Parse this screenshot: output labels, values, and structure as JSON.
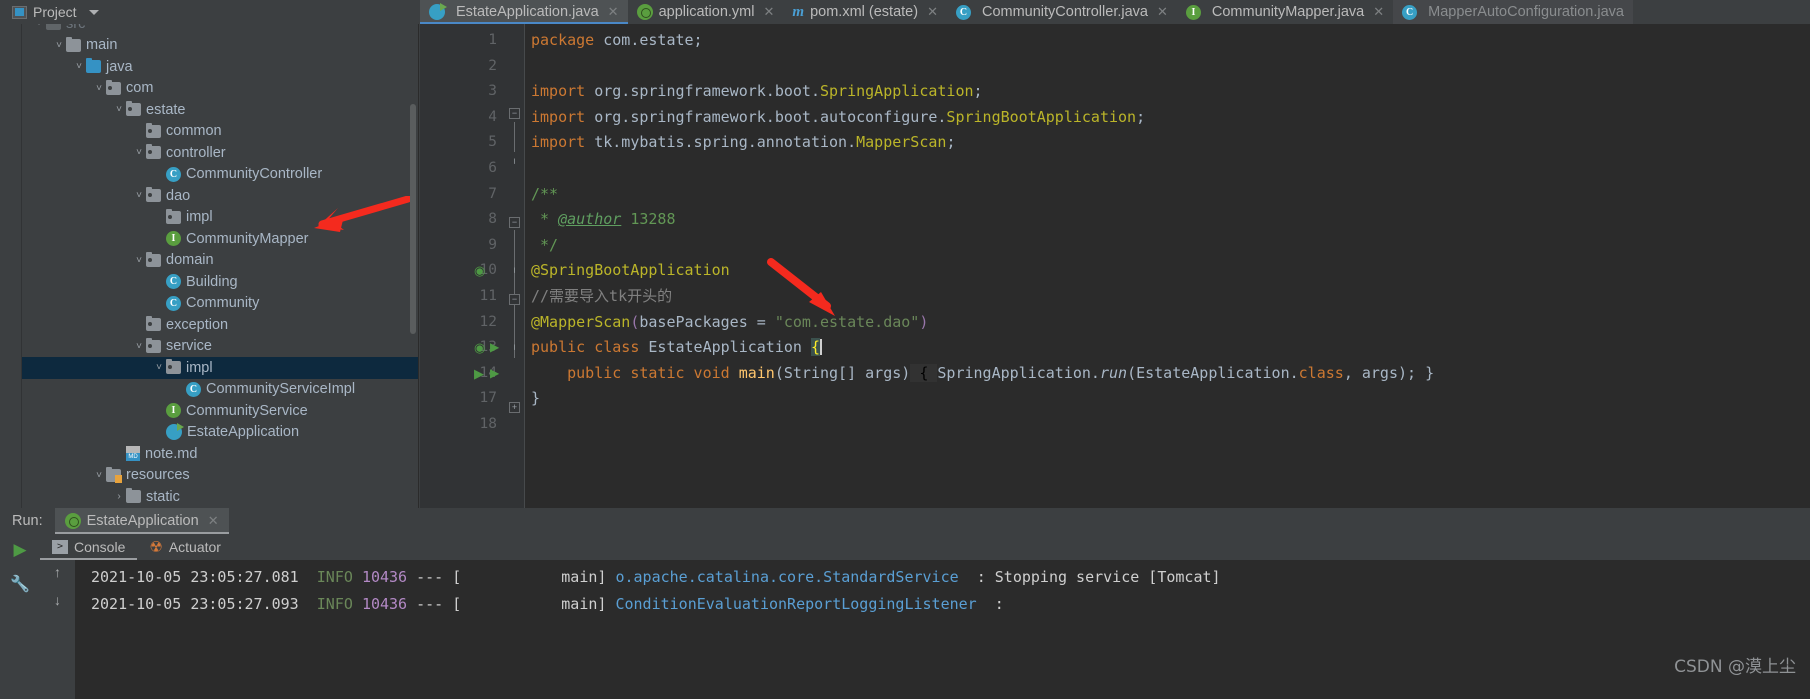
{
  "topbar": {
    "project_label": "Project",
    "icons": [
      "locate-icon",
      "expand-all-icon",
      "collapse-all-icon",
      "settings-gear-icon",
      "minimize-icon"
    ]
  },
  "sidebar": {
    "items": [
      {
        "label": "src",
        "indent": 2,
        "twisty": "v",
        "icon": "folder-source",
        "selected": false,
        "partial": true
      },
      {
        "label": "main",
        "indent": 3,
        "twisty": "v",
        "icon": "folder-source",
        "selected": false
      },
      {
        "label": "java",
        "indent": 4,
        "twisty": "v",
        "icon": "folder-blue",
        "selected": false
      },
      {
        "label": "com",
        "indent": 5,
        "twisty": "v",
        "icon": "folder-package",
        "selected": false
      },
      {
        "label": "estate",
        "indent": 6,
        "twisty": "v",
        "icon": "folder-package",
        "selected": false
      },
      {
        "label": "common",
        "indent": 7,
        "twisty": "",
        "icon": "folder-package",
        "selected": false
      },
      {
        "label": "controller",
        "indent": 7,
        "twisty": "v",
        "icon": "folder-package",
        "selected": false
      },
      {
        "label": "CommunityController",
        "indent": 8,
        "twisty": "",
        "icon": "class-icon",
        "selected": false
      },
      {
        "label": "dao",
        "indent": 7,
        "twisty": "v",
        "icon": "folder-package",
        "selected": false
      },
      {
        "label": "impl",
        "indent": 8,
        "twisty": "",
        "icon": "folder-package",
        "selected": false
      },
      {
        "label": "CommunityMapper",
        "indent": 8,
        "twisty": "",
        "icon": "interface-icon",
        "selected": false
      },
      {
        "label": "domain",
        "indent": 7,
        "twisty": "v",
        "icon": "folder-package",
        "selected": false
      },
      {
        "label": "Building",
        "indent": 8,
        "twisty": "",
        "icon": "class-icon",
        "selected": false
      },
      {
        "label": "Community",
        "indent": 8,
        "twisty": "",
        "icon": "class-icon",
        "selected": false
      },
      {
        "label": "exception",
        "indent": 7,
        "twisty": "",
        "icon": "folder-package",
        "selected": false
      },
      {
        "label": "service",
        "indent": 7,
        "twisty": "v",
        "icon": "folder-package",
        "selected": false
      },
      {
        "label": "impl",
        "indent": 8,
        "twisty": "v",
        "icon": "folder-package",
        "selected": true
      },
      {
        "label": "CommunityServiceImpl",
        "indent": 9,
        "twisty": "",
        "icon": "class-icon",
        "selected": false
      },
      {
        "label": "CommunityService",
        "indent": 8,
        "twisty": "",
        "icon": "interface-icon",
        "selected": false
      },
      {
        "label": "EstateApplication",
        "indent": 8,
        "twisty": "",
        "icon": "spring-class-icon",
        "selected": false
      },
      {
        "label": "note.md",
        "indent": 6,
        "twisty": "",
        "icon": "markdown-icon",
        "selected": false
      },
      {
        "label": "resources",
        "indent": 5,
        "twisty": "v",
        "icon": "folder-resources",
        "selected": false
      },
      {
        "label": "static",
        "indent": 6,
        "twisty": ">",
        "icon": "folder-plain",
        "selected": false
      }
    ]
  },
  "tabs": [
    {
      "label": "EstateApplication.java",
      "icon": "spring-class-icon",
      "active": true,
      "closable": true
    },
    {
      "label": "application.yml",
      "icon": "spring-yaml-icon",
      "active": false,
      "closable": true
    },
    {
      "label": "pom.xml (estate)",
      "icon": "maven-icon",
      "active": false,
      "closable": true
    },
    {
      "label": "CommunityController.java",
      "icon": "class-icon",
      "active": false,
      "closable": true
    },
    {
      "label": "CommunityMapper.java",
      "icon": "interface-icon",
      "active": false,
      "closable": true
    },
    {
      "label": "MapperAutoConfiguration.java",
      "icon": "class-library-icon",
      "active": false,
      "closable": false
    }
  ],
  "editor": {
    "line_numbers": [
      "1",
      "2",
      "3",
      "4",
      "5",
      "6",
      "7",
      "8",
      "9",
      "10",
      "11",
      "12",
      "13",
      "14",
      "17",
      "18"
    ],
    "lines": [
      "package com.estate;",
      "",
      "import org.springframework.boot.SpringApplication;",
      "import org.springframework.boot.autoconfigure.SpringBootApplication;",
      "import tk.mybatis.spring.annotation.MapperScan;",
      "",
      "/**",
      " * @author 13288",
      " */",
      "@SpringBootApplication",
      "//需要导入tk开头的",
      "@MapperScan(basePackages = \"com.estate.dao\")",
      "public class EstateApplication {",
      "    public static void main(String[] args) { SpringApplication.run(EstateApplication.class, args); }",
      "}",
      ""
    ],
    "gutter_run_markers": [
      "10",
      "13",
      "14"
    ]
  },
  "run_panel": {
    "run_label": "Run:",
    "config_name": "EstateApplication",
    "config_icon": "spring-run-icon",
    "subtabs": [
      {
        "label": "Console",
        "icon": "console-icon",
        "active": true
      },
      {
        "label": "Actuator",
        "icon": "actuator-icon",
        "active": false
      }
    ],
    "tool_icons": [
      "run-icon",
      "wrench-icon",
      "scroll-up-icon",
      "scroll-down-icon"
    ],
    "log_lines": [
      {
        "timestamp": "2021-10-05 23:05:27.081",
        "level": "INFO",
        "pid": "10436",
        "sep": "--- [",
        "thread": "main]",
        "logger": "o.apache.catalina.core.StandardService",
        "colon": ": ",
        "message": "Stopping service [Tomcat]"
      },
      {
        "timestamp": "2021-10-05 23:05:27.093",
        "level": "INFO",
        "pid": "10436",
        "sep": "--- [",
        "thread": "main]",
        "logger": "ConditionEvaluationReportLoggingListener",
        "colon": ":",
        "message": ""
      }
    ]
  },
  "annotations": {
    "arrow_1": "red-arrow-pointing-to-impl-folder",
    "arrow_2": "red-arrow-pointing-to-mapperscan-annotation"
  },
  "watermark": {
    "text": "CSDN @漠上尘"
  },
  "colors": {
    "accent_blue": "#4a88c7",
    "selection_blue": "#0d293e",
    "editor_bg": "#2b2b2b",
    "panel_bg": "#3c3f41",
    "arrow_red": "#f03030"
  }
}
